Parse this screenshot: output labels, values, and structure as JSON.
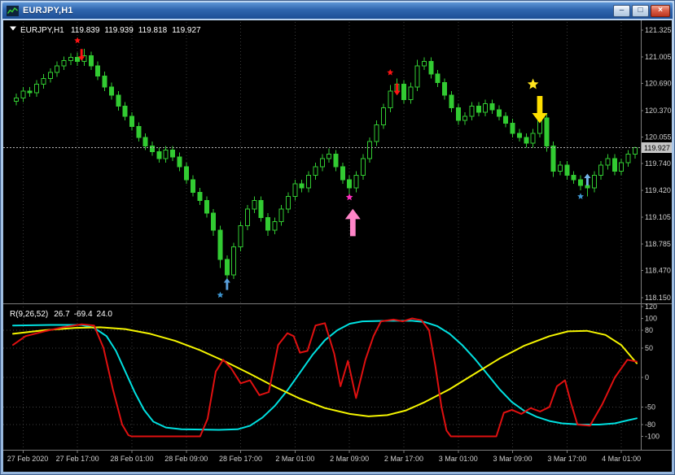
{
  "window": {
    "title": "EURJPY,H1",
    "icons": {
      "minimize": "–",
      "maximize": "□",
      "close": "×"
    }
  },
  "chart_data": {
    "type": "candlestick",
    "symbol": "EURJPY",
    "period": "H1",
    "ohlc_header": {
      "symbol_period": "EURJPY,H1",
      "open": "119.839",
      "high": "119.939",
      "low": "119.818",
      "close": "119.927"
    },
    "price_axis": {
      "ticks": [
        "121.325",
        "121.005",
        "120.690",
        "120.370",
        "120.055",
        "119.740",
        "119.420",
        "119.105",
        "118.785",
        "118.470",
        "118.150"
      ],
      "current": "119.927",
      "max": 121.42,
      "min": 118.1
    },
    "time_axis": {
      "labels": [
        "27 Feb 2020",
        "27 Feb 17:00",
        "28 Feb 01:00",
        "28 Feb 09:00",
        "28 Feb 17:00",
        "2 Mar 01:00",
        "2 Mar 09:00",
        "2 Mar 17:00",
        "3 Mar 01:00",
        "3 Mar 09:00",
        "3 Mar 17:00",
        "4 Mar 01:00"
      ]
    },
    "candles": [
      [
        120.48,
        120.57,
        120.43,
        120.52
      ],
      [
        120.52,
        120.65,
        120.47,
        120.6
      ],
      [
        120.6,
        120.65,
        120.53,
        120.58
      ],
      [
        120.58,
        120.73,
        120.53,
        120.68
      ],
      [
        120.68,
        120.8,
        120.63,
        120.75
      ],
      [
        120.75,
        120.87,
        120.7,
        120.82
      ],
      [
        120.82,
        120.95,
        120.77,
        120.9
      ],
      [
        120.9,
        121.01,
        120.85,
        120.96
      ],
      [
        120.96,
        121.05,
        120.91,
        121.0
      ],
      [
        121.0,
        121.06,
        120.9,
        120.95
      ],
      [
        120.95,
        121.1,
        120.9,
        121.02
      ],
      [
        121.02,
        121.07,
        120.85,
        120.9
      ],
      [
        120.9,
        120.95,
        120.73,
        120.78
      ],
      [
        120.78,
        120.83,
        120.6,
        120.65
      ],
      [
        120.65,
        120.7,
        120.5,
        120.55
      ],
      [
        120.55,
        120.6,
        120.37,
        120.42
      ],
      [
        120.42,
        120.47,
        120.25,
        120.3
      ],
      [
        120.3,
        120.35,
        120.13,
        120.18
      ],
      [
        120.18,
        120.23,
        120.0,
        120.05
      ],
      [
        120.05,
        120.1,
        119.9,
        119.95
      ],
      [
        119.95,
        120.0,
        119.83,
        119.88
      ],
      [
        119.88,
        119.93,
        119.75,
        119.8
      ],
      [
        119.8,
        119.95,
        119.75,
        119.9
      ],
      [
        119.9,
        119.95,
        119.77,
        119.82
      ],
      [
        119.82,
        119.87,
        119.65,
        119.7
      ],
      [
        119.7,
        119.75,
        119.5,
        119.55
      ],
      [
        119.55,
        119.6,
        119.35,
        119.4
      ],
      [
        119.4,
        119.45,
        119.25,
        119.3
      ],
      [
        119.3,
        119.35,
        119.1,
        119.15
      ],
      [
        119.15,
        119.2,
        118.88,
        118.95
      ],
      [
        118.95,
        119.0,
        118.5,
        118.6
      ],
      [
        118.6,
        118.65,
        118.3,
        118.42
      ],
      [
        118.42,
        118.8,
        118.37,
        118.75
      ],
      [
        118.75,
        119.05,
        118.7,
        119.0
      ],
      [
        119.0,
        119.25,
        118.95,
        119.2
      ],
      [
        119.2,
        119.35,
        119.15,
        119.3
      ],
      [
        119.3,
        119.35,
        119.05,
        119.1
      ],
      [
        119.1,
        119.15,
        118.88,
        118.95
      ],
      [
        118.95,
        119.1,
        118.9,
        119.05
      ],
      [
        119.05,
        119.25,
        119.0,
        119.2
      ],
      [
        119.2,
        119.4,
        119.15,
        119.35
      ],
      [
        119.35,
        119.55,
        119.3,
        119.5
      ],
      [
        119.5,
        119.55,
        119.4,
        119.45
      ],
      [
        119.45,
        119.65,
        119.4,
        119.6
      ],
      [
        119.6,
        119.75,
        119.55,
        119.7
      ],
      [
        119.7,
        119.85,
        119.65,
        119.8
      ],
      [
        119.8,
        119.92,
        119.75,
        119.85
      ],
      [
        119.85,
        119.9,
        119.65,
        119.7
      ],
      [
        119.7,
        119.75,
        119.5,
        119.55
      ],
      [
        119.55,
        119.6,
        119.33,
        119.45
      ],
      [
        119.45,
        119.65,
        119.4,
        119.6
      ],
      [
        119.6,
        119.85,
        119.55,
        119.8
      ],
      [
        119.8,
        120.05,
        119.75,
        120.0
      ],
      [
        120.0,
        120.25,
        119.95,
        120.2
      ],
      [
        120.2,
        120.45,
        120.15,
        120.4
      ],
      [
        120.4,
        120.67,
        120.35,
        120.6
      ],
      [
        120.6,
        120.75,
        120.55,
        120.68
      ],
      [
        120.68,
        120.73,
        120.45,
        120.5
      ],
      [
        120.5,
        120.7,
        120.45,
        120.65
      ],
      [
        120.65,
        120.97,
        120.6,
        120.9
      ],
      [
        120.9,
        121.0,
        120.85,
        120.95
      ],
      [
        120.95,
        121.0,
        120.75,
        120.8
      ],
      [
        120.8,
        120.85,
        120.65,
        120.7
      ],
      [
        120.7,
        120.75,
        120.5,
        120.55
      ],
      [
        120.55,
        120.6,
        120.35,
        120.4
      ],
      [
        120.4,
        120.45,
        120.2,
        120.25
      ],
      [
        120.25,
        120.35,
        120.2,
        120.3
      ],
      [
        120.3,
        120.47,
        120.25,
        120.42
      ],
      [
        120.42,
        120.47,
        120.3,
        120.35
      ],
      [
        120.35,
        120.5,
        120.3,
        120.45
      ],
      [
        120.45,
        120.5,
        120.33,
        120.38
      ],
      [
        120.38,
        120.43,
        120.25,
        120.3
      ],
      [
        120.3,
        120.35,
        120.17,
        120.22
      ],
      [
        120.22,
        120.27,
        120.05,
        120.1
      ],
      [
        120.1,
        120.15,
        120.0,
        120.05
      ],
      [
        120.05,
        120.1,
        119.93,
        119.98
      ],
      [
        119.98,
        120.15,
        119.93,
        120.1
      ],
      [
        120.1,
        120.38,
        120.05,
        120.28
      ],
      [
        120.28,
        120.33,
        119.88,
        119.95
      ],
      [
        119.95,
        120.0,
        119.58,
        119.65
      ],
      [
        119.65,
        119.77,
        119.6,
        119.72
      ],
      [
        119.72,
        119.77,
        119.55,
        119.6
      ],
      [
        119.6,
        119.65,
        119.5,
        119.55
      ],
      [
        119.55,
        119.6,
        119.42,
        119.48
      ],
      [
        119.48,
        119.53,
        119.35,
        119.45
      ],
      [
        119.45,
        119.65,
        119.4,
        119.6
      ],
      [
        119.6,
        119.77,
        119.55,
        119.72
      ],
      [
        119.72,
        119.85,
        119.67,
        119.8
      ],
      [
        119.8,
        119.85,
        119.6,
        119.65
      ],
      [
        119.65,
        119.8,
        119.6,
        119.75
      ],
      [
        119.75,
        119.9,
        119.7,
        119.85
      ],
      [
        119.85,
        119.94,
        119.8,
        119.927
      ]
    ],
    "markers": [
      {
        "name": "sell-star-1",
        "shape": "star",
        "color": "#FF1414",
        "i": 9,
        "p": 121.2,
        "s": 1
      },
      {
        "name": "sell-arrow-1",
        "shape": "arrow-down",
        "color": "#FF1414",
        "i": 9.6,
        "p": 121.03,
        "s": 0.9
      },
      {
        "name": "buy-arrow-1",
        "shape": "arrow-up",
        "color": "#5AA0DC",
        "i": 31,
        "p": 118.31,
        "s": 0.9
      },
      {
        "name": "buy-star-1",
        "shape": "star",
        "color": "#3E96D2",
        "i": 30,
        "p": 118.18,
        "s": 1
      },
      {
        "name": "buy-star-2",
        "shape": "star",
        "color": "#FF30C0",
        "i": 49,
        "p": 119.34,
        "s": 1.1
      },
      {
        "name": "buy-big-arrow",
        "shape": "arrow-up",
        "color": "#FF85C8",
        "i": 49.5,
        "p": 119.04,
        "s": 2.1
      },
      {
        "name": "sell-star-2",
        "shape": "star",
        "color": "#FF1414",
        "i": 55,
        "p": 120.82,
        "s": 1
      },
      {
        "name": "sell-arrow-2",
        "shape": "arrow-down",
        "color": "#FF1414",
        "i": 56,
        "p": 120.62,
        "s": 0.9
      },
      {
        "name": "sell-star-3",
        "shape": "star",
        "color": "#FFE41E",
        "i": 76,
        "p": 120.68,
        "s": 1.7
      },
      {
        "name": "sell-big-arrow",
        "shape": "arrow-down",
        "color": "#FFDF00",
        "i": 77,
        "p": 120.38,
        "s": 2.1
      },
      {
        "name": "buy-arrow-2",
        "shape": "arrow-up",
        "color": "#74B4E8",
        "i": 84,
        "p": 119.55,
        "s": 0.9
      },
      {
        "name": "buy-star-3",
        "shape": "star",
        "color": "#3E96D2",
        "i": 83,
        "p": 119.35,
        "s": 1
      }
    ],
    "indicator": {
      "label": "R(9,26,52)",
      "values": [
        "26.7",
        "-69.4",
        "24.0"
      ],
      "axis_ticks": [
        120,
        100,
        80,
        50,
        0,
        -50,
        -80,
        -100
      ],
      "levels": [
        80,
        50,
        0,
        -50,
        -80
      ],
      "range": [
        -120,
        120
      ],
      "series": [
        {
          "name": "cyan",
          "color": "#00E0E0",
          "points": [
            [
              0.0,
              88
            ],
            [
              0.06,
              89
            ],
            [
              0.11,
              89
            ],
            [
              0.13,
              84
            ],
            [
              0.15,
              70
            ],
            [
              0.165,
              45
            ],
            [
              0.18,
              10
            ],
            [
              0.195,
              -25
            ],
            [
              0.21,
              -55
            ],
            [
              0.225,
              -75
            ],
            [
              0.245,
              -85
            ],
            [
              0.27,
              -88
            ],
            [
              0.33,
              -89
            ],
            [
              0.36,
              -88
            ],
            [
              0.38,
              -82
            ],
            [
              0.4,
              -68
            ],
            [
              0.42,
              -48
            ],
            [
              0.44,
              -22
            ],
            [
              0.46,
              8
            ],
            [
              0.48,
              38
            ],
            [
              0.5,
              63
            ],
            [
              0.52,
              80
            ],
            [
              0.54,
              91
            ],
            [
              0.56,
              95
            ],
            [
              0.6,
              96
            ],
            [
              0.64,
              96
            ],
            [
              0.66,
              94
            ],
            [
              0.68,
              87
            ],
            [
              0.7,
              74
            ],
            [
              0.72,
              55
            ],
            [
              0.74,
              32
            ],
            [
              0.76,
              6
            ],
            [
              0.78,
              -20
            ],
            [
              0.8,
              -42
            ],
            [
              0.82,
              -57
            ],
            [
              0.84,
              -67
            ],
            [
              0.86,
              -74
            ],
            [
              0.88,
              -78
            ],
            [
              0.91,
              -80
            ],
            [
              0.94,
              -80
            ],
            [
              0.965,
              -78
            ],
            [
              0.985,
              -73
            ],
            [
              1.0,
              -69.4
            ]
          ]
        },
        {
          "name": "yellow",
          "color": "#F5F500",
          "points": [
            [
              0.0,
              74
            ],
            [
              0.05,
              80
            ],
            [
              0.1,
              84
            ],
            [
              0.14,
              85
            ],
            [
              0.18,
              82
            ],
            [
              0.22,
              74
            ],
            [
              0.26,
              62
            ],
            [
              0.3,
              46
            ],
            [
              0.34,
              27
            ],
            [
              0.38,
              6
            ],
            [
              0.42,
              -16
            ],
            [
              0.46,
              -36
            ],
            [
              0.5,
              -52
            ],
            [
              0.54,
              -62
            ],
            [
              0.57,
              -66
            ],
            [
              0.6,
              -64
            ],
            [
              0.63,
              -56
            ],
            [
              0.66,
              -42
            ],
            [
              0.7,
              -20
            ],
            [
              0.74,
              6
            ],
            [
              0.78,
              32
            ],
            [
              0.82,
              54
            ],
            [
              0.86,
              70
            ],
            [
              0.89,
              78
            ],
            [
              0.92,
              79
            ],
            [
              0.95,
              72
            ],
            [
              0.975,
              55
            ],
            [
              1.0,
              24
            ]
          ]
        },
        {
          "name": "red",
          "color": "#E01010",
          "points": [
            [
              0.0,
              55
            ],
            [
              0.02,
              70
            ],
            [
              0.05,
              78
            ],
            [
              0.08,
              85
            ],
            [
              0.11,
              90
            ],
            [
              0.13,
              88
            ],
            [
              0.145,
              50
            ],
            [
              0.16,
              -20
            ],
            [
              0.175,
              -80
            ],
            [
              0.185,
              -98
            ],
            [
              0.19,
              -100
            ],
            [
              0.3,
              -100
            ],
            [
              0.312,
              -70
            ],
            [
              0.325,
              10
            ],
            [
              0.337,
              30
            ],
            [
              0.35,
              15
            ],
            [
              0.365,
              -10
            ],
            [
              0.38,
              -5
            ],
            [
              0.395,
              -30
            ],
            [
              0.41,
              -25
            ],
            [
              0.425,
              55
            ],
            [
              0.44,
              75
            ],
            [
              0.45,
              70
            ],
            [
              0.46,
              42
            ],
            [
              0.472,
              45
            ],
            [
              0.485,
              88
            ],
            [
              0.5,
              92
            ],
            [
              0.515,
              40
            ],
            [
              0.525,
              -15
            ],
            [
              0.537,
              28
            ],
            [
              0.55,
              -35
            ],
            [
              0.565,
              30
            ],
            [
              0.578,
              70
            ],
            [
              0.59,
              95
            ],
            [
              0.61,
              98
            ],
            [
              0.625,
              95
            ],
            [
              0.64,
              100
            ],
            [
              0.655,
              97
            ],
            [
              0.667,
              80
            ],
            [
              0.677,
              20
            ],
            [
              0.687,
              -50
            ],
            [
              0.695,
              -90
            ],
            [
              0.702,
              -100
            ],
            [
              0.775,
              -100
            ],
            [
              0.787,
              -60
            ],
            [
              0.8,
              -55
            ],
            [
              0.815,
              -62
            ],
            [
              0.83,
              -52
            ],
            [
              0.845,
              -58
            ],
            [
              0.86,
              -50
            ],
            [
              0.872,
              -15
            ],
            [
              0.885,
              -5
            ],
            [
              0.895,
              -45
            ],
            [
              0.905,
              -80
            ],
            [
              0.925,
              -82
            ],
            [
              0.945,
              -45
            ],
            [
              0.965,
              0
            ],
            [
              0.985,
              30
            ],
            [
              1.0,
              26.7
            ]
          ]
        }
      ]
    },
    "colors": {
      "background": "#000000",
      "candle": "#32CB32",
      "bull_fill": "#000000",
      "grid": "#3A3A3A",
      "level": "#404040",
      "separator": "#7D7D7D",
      "axis_text": "#CFCFCF",
      "price_line": "#B4B4B4",
      "price_label_bg": "#C6C6C6",
      "price_label_text": "#000000"
    }
  }
}
